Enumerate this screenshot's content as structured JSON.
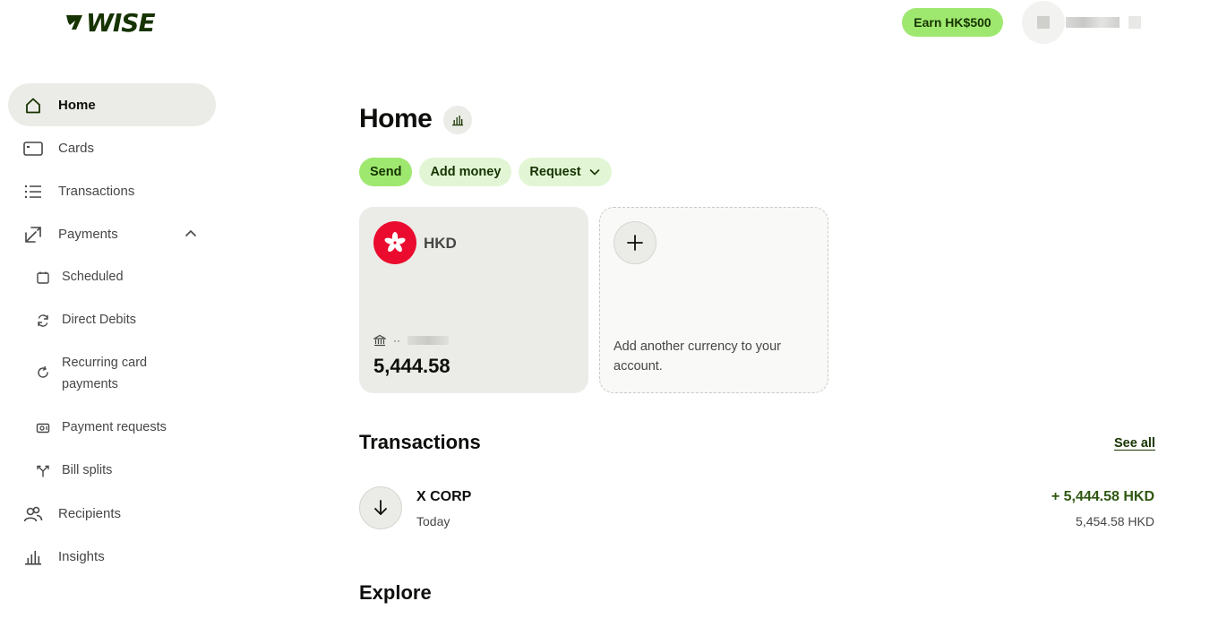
{
  "header": {
    "logo_text": "WISE",
    "earn_label": "Earn HK$500"
  },
  "sidebar": {
    "items": [
      {
        "label": "Home",
        "icon": "home-icon",
        "active": true
      },
      {
        "label": "Cards",
        "icon": "card-icon"
      },
      {
        "label": "Transactions",
        "icon": "list-icon"
      },
      {
        "label": "Payments",
        "icon": "payments-icon",
        "expanded": true
      },
      {
        "label": "Recipients",
        "icon": "recipients-icon"
      },
      {
        "label": "Insights",
        "icon": "insights-icon"
      }
    ],
    "payments_sub": [
      {
        "label": "Scheduled",
        "icon": "calendar-icon"
      },
      {
        "label": "Direct Debits",
        "icon": "refresh-icon"
      },
      {
        "label": "Recurring card payments",
        "icon": "recurring-icon"
      },
      {
        "label": "Payment requests",
        "icon": "payment-request-icon"
      },
      {
        "label": "Bill splits",
        "icon": "bill-split-icon"
      }
    ]
  },
  "main": {
    "title": "Home",
    "actions": {
      "send": "Send",
      "add_money": "Add money",
      "request": "Request"
    },
    "balance": {
      "currency": "HKD",
      "account_prefix": "··",
      "amount": "5,444.58",
      "flag_color": "#ea0b2e"
    },
    "add_currency_text": "Add another currency to your account.",
    "transactions": {
      "title": "Transactions",
      "see_all": "See all",
      "rows": [
        {
          "name": "X CORP",
          "date": "Today",
          "amount": "+ 5,444.58 HKD",
          "sub_amount": "5,454.58 HKD"
        }
      ]
    },
    "explore_title": "Explore"
  },
  "colors": {
    "brand_green": "#9fe870",
    "forest": "#163300",
    "positive_amount": "#2f5711"
  }
}
